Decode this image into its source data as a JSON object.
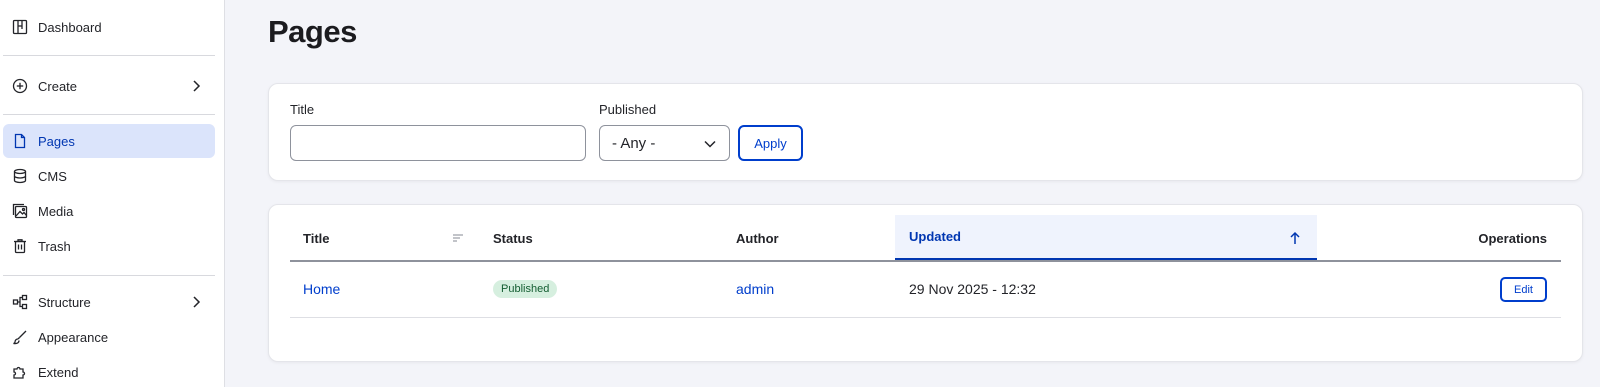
{
  "sidebar": {
    "items": [
      {
        "label": "Dashboard",
        "icon": "dashboard-icon"
      },
      {
        "label": "Create",
        "icon": "plus-circle-icon"
      },
      {
        "label": "Pages",
        "icon": "page-icon"
      },
      {
        "label": "CMS",
        "icon": "database-icon"
      },
      {
        "label": "Media",
        "icon": "media-icon"
      },
      {
        "label": "Trash",
        "icon": "trash-icon"
      },
      {
        "label": "Structure",
        "icon": "structure-icon"
      },
      {
        "label": "Appearance",
        "icon": "brush-icon"
      },
      {
        "label": "Extend",
        "icon": "puzzle-icon"
      }
    ]
  },
  "page": {
    "title": "Pages"
  },
  "filters": {
    "title_label": "Title",
    "title_value": "",
    "published_label": "Published",
    "published_value": "- Any -",
    "apply_label": "Apply"
  },
  "table": {
    "columns": [
      "Title",
      "Status",
      "Author",
      "Updated",
      "Operations"
    ],
    "sorted_column": "Updated",
    "rows": [
      {
        "title": "Home",
        "status": "Published",
        "author": "admin",
        "updated": "29 Nov 2025 - 12:32",
        "operation": "Edit"
      }
    ]
  },
  "colors": {
    "accent": "#003ecc",
    "active_bg": "#dbe4fb",
    "badge_bg": "#d6efdf",
    "badge_text": "#135d31"
  }
}
